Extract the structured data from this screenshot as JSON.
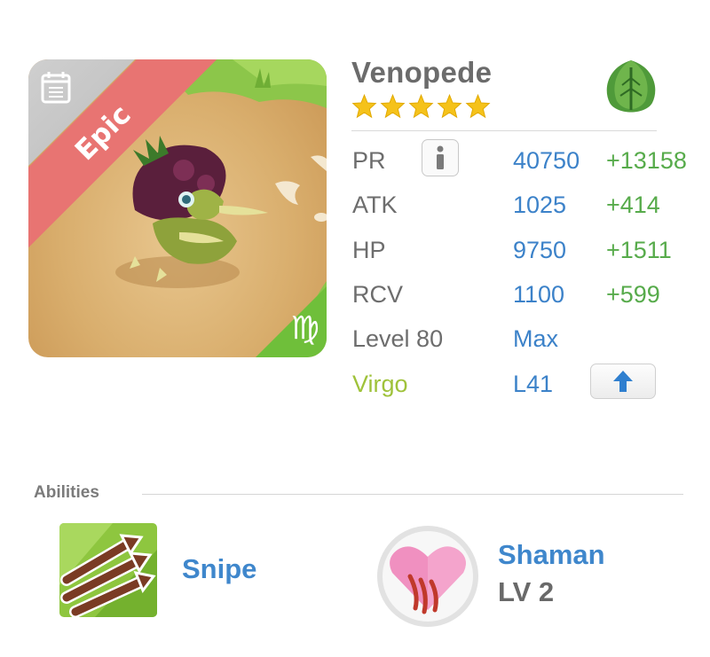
{
  "monster": {
    "rarity": "Epic",
    "name": "Venopede",
    "star_count": 5,
    "element_icon": "leaf-icon",
    "zodiac_icon": "virgo-icon"
  },
  "stats": [
    {
      "label": "PR",
      "value": "40750",
      "bonus": "+13158"
    },
    {
      "label": "ATK",
      "value": "1025",
      "bonus": "+414"
    },
    {
      "label": "HP",
      "value": "9750",
      "bonus": "+1511"
    },
    {
      "label": "RCV",
      "value": "1100",
      "bonus": "+599"
    }
  ],
  "level": {
    "label": "Level 80",
    "value": "Max"
  },
  "sign": {
    "label": "Virgo",
    "value": "L41"
  },
  "abilities": {
    "title": "Abilities",
    "items": [
      {
        "name": "Snipe",
        "icon": "arrows-icon"
      },
      {
        "name": "Shaman",
        "level": "LV 2",
        "icon": "heart-icon"
      }
    ]
  },
  "colors": {
    "stat_value": "#3c82c9",
    "stat_bonus": "#57ab4b",
    "sign_label": "#9fc23a",
    "epic_ribbon": "#e87472",
    "star": "#f5c21a"
  }
}
